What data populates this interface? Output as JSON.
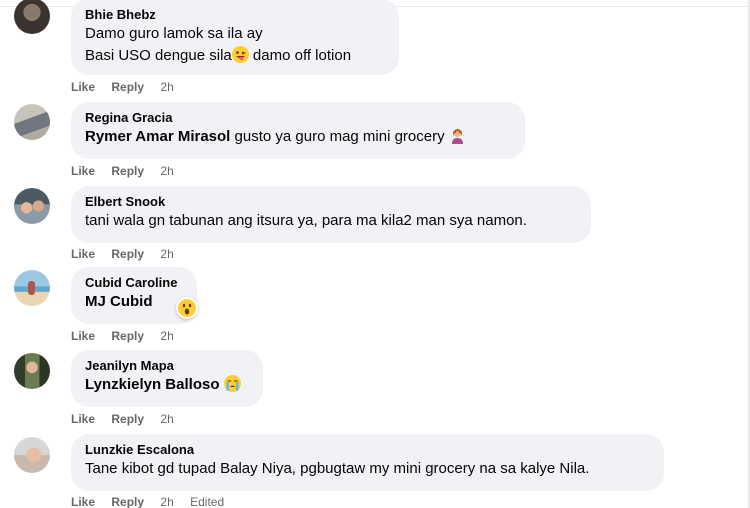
{
  "comments": [
    {
      "author": "Bhie Bhebz",
      "lines": [
        "Damo guro lamok sa ila ay",
        "Basi USO dengue sila",
        " damo off lotion"
      ],
      "actions": {
        "like": "Like",
        "reply": "Reply",
        "time": "2h"
      },
      "emoji": "grinning-tongue-wink-emoji"
    },
    {
      "author": "Regina Gracia",
      "tag": "Rymer Amar Mirasol",
      "text": " gusto ya guro mag mini grocery",
      "actions": {
        "like": "Like",
        "reply": "Reply",
        "time": "2h"
      },
      "emoji": "person-facepalming-emoji"
    },
    {
      "author": "Elbert Snook",
      "text": "tani wala gn tabunan ang itsura ya, para ma kila2 man sya namon.",
      "actions": {
        "like": "Like",
        "reply": "Reply",
        "time": "2h"
      }
    },
    {
      "author": "Cubid Caroline",
      "tag": "MJ Cubid",
      "actions": {
        "like": "Like",
        "reply": "Reply",
        "time": "2h"
      },
      "reaction": "wow-reaction-emoji"
    },
    {
      "author": "Jeanilyn Mapa",
      "tag": "Lynzkielyn Balloso",
      "actions": {
        "like": "Like",
        "reply": "Reply",
        "time": "2h"
      },
      "emoji": "crying-face-emoji"
    },
    {
      "author": "Lunzkie Escalona",
      "text": "Tane kibot gd tupad Balay Niya, pgbugtaw my mini grocery na sa kalye Nila.",
      "actions": {
        "like": "Like",
        "reply": "Reply",
        "time": "2h",
        "edited": "Edited"
      }
    }
  ],
  "colors": {
    "bubble": "#f0f2f5",
    "secondary_text": "#65676b",
    "primary_text": "#050505",
    "emoji_yellow": "#ffcc33"
  }
}
